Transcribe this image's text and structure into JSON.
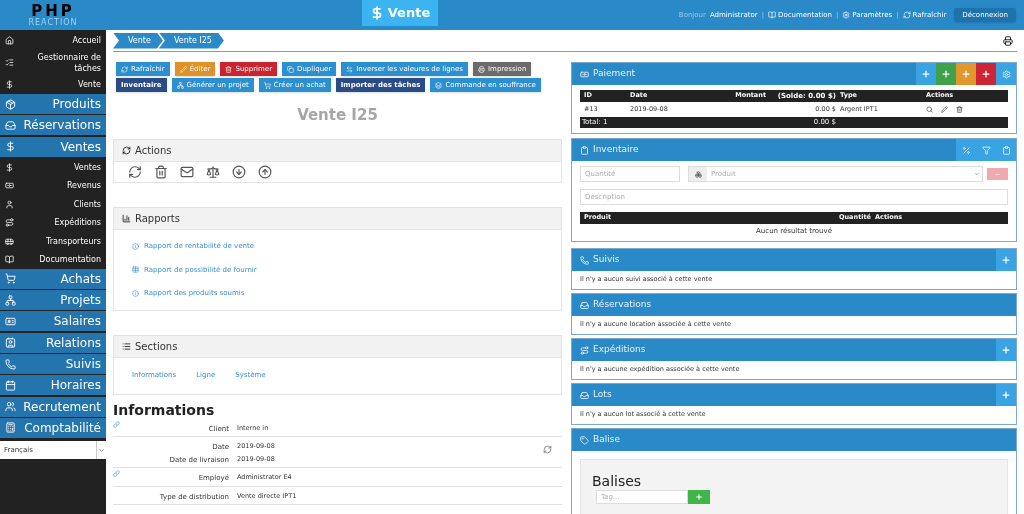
{
  "topbar": {
    "logo": "PHP",
    "logo_sub": "REACTION",
    "page_title": "Vente",
    "greeting": "Bonjour",
    "user": "Administrator",
    "separator": "|",
    "links": [
      "Documentation",
      "Paramètres",
      "Rafraîchir"
    ],
    "logout": "Déconnexion"
  },
  "sidebar": {
    "items": [
      {
        "kind": "link",
        "label": "Accueil"
      },
      {
        "kind": "link",
        "label": "Gestionnaire de tâches"
      },
      {
        "kind": "link",
        "label": "Vente"
      },
      {
        "kind": "section",
        "label": "Produits"
      },
      {
        "kind": "section",
        "label": "Réservations"
      },
      {
        "kind": "section",
        "label": "Ventes"
      },
      {
        "kind": "link",
        "label": "Ventes"
      },
      {
        "kind": "link",
        "label": "Revenus"
      },
      {
        "kind": "link",
        "label": "Clients"
      },
      {
        "kind": "link",
        "label": "Expéditions"
      },
      {
        "kind": "link",
        "label": "Transporteurs"
      },
      {
        "kind": "link",
        "label": "Documentation"
      },
      {
        "kind": "section",
        "label": "Achats"
      },
      {
        "kind": "section",
        "label": "Projets"
      },
      {
        "kind": "section",
        "label": "Salaires"
      },
      {
        "kind": "section",
        "label": "Relations"
      },
      {
        "kind": "section",
        "label": "Suivis"
      },
      {
        "kind": "section",
        "label": "Horaires"
      },
      {
        "kind": "section",
        "label": "Recrutement"
      },
      {
        "kind": "section",
        "label": "Comptabilité"
      }
    ],
    "language": "Français"
  },
  "breadcrumb": [
    "Vente",
    "Vente I25"
  ],
  "toolbar": [
    {
      "label": "Rafraîchir",
      "kind": "info"
    },
    {
      "label": "Éditer",
      "kind": "warning"
    },
    {
      "label": "Supprimer",
      "kind": "danger"
    },
    {
      "label": "Dupliquer",
      "kind": "info"
    },
    {
      "label": "Inverser les valeures de lignes",
      "kind": "info"
    },
    {
      "label": "Impression",
      "kind": "muted"
    },
    {
      "label": "Inventaire",
      "kind": "dark"
    },
    {
      "label": "Générer un projet",
      "kind": "info"
    },
    {
      "label": "Créer un achat",
      "kind": "info"
    },
    {
      "label": "Importer des tâches",
      "kind": "dark"
    },
    {
      "label": "Commande en souffrance",
      "kind": "info"
    }
  ],
  "title": "Vente I25",
  "actions_panel": {
    "title": "Actions"
  },
  "reports_panel": {
    "title": "Rapports",
    "links": [
      "Rapport de rentabilité de vente",
      "Rapport de possibilité de fournir",
      "Rapport des produits soumis"
    ]
  },
  "sections_panel": {
    "title": "Sections",
    "links": [
      "Informations",
      "Ligne",
      "Système"
    ]
  },
  "informations": {
    "title": "Informations",
    "rows": [
      {
        "linked": true,
        "refresh": false,
        "fields": [
          {
            "label": "Client",
            "value": "Interne in"
          }
        ]
      },
      {
        "linked": false,
        "refresh": true,
        "fields": [
          {
            "label": "Date",
            "value": "2019-09-08"
          },
          {
            "label": "Date de livraison",
            "value": "2019-09-08"
          }
        ]
      },
      {
        "linked": true,
        "refresh": false,
        "fields": [
          {
            "label": "Employé",
            "value": "Administrator E4"
          }
        ]
      },
      {
        "linked": false,
        "refresh": false,
        "fields": [
          {
            "label": "Type de distribution",
            "value": "Vente directe IPT1"
          }
        ]
      }
    ]
  },
  "payment": {
    "title": "Paiement",
    "header_buttons": [
      {
        "kind": "add",
        "color": "#3aa3e3"
      },
      {
        "kind": "add",
        "color": "#3fa14a"
      },
      {
        "kind": "add",
        "color": "#e0982e"
      },
      {
        "kind": "add",
        "color": "#cc2535"
      },
      {
        "kind": "settings",
        "color": "#3aa3e3"
      }
    ],
    "columns": [
      "ID",
      "Date",
      "Montant",
      "(Solde: 0.00 $)",
      "Type",
      "Actions"
    ],
    "rows": [
      {
        "id": "#13",
        "date": "2019-09-08",
        "amount": "0.00 $",
        "type": "Argent IPT1"
      }
    ],
    "footer": {
      "total": "Total: 1",
      "amount": "0.00 $"
    }
  },
  "inventory": {
    "title": "Inventaire",
    "quantity_placeholder": "Quantité",
    "product_placeholder": "Produit",
    "description_placeholder": "Description",
    "columns": [
      "Produit",
      "Quantité",
      "Actions"
    ],
    "empty": "Aucun résultat trouvé"
  },
  "panels": [
    {
      "title": "Suivis",
      "message": "Il n'y a aucun suivi associé à cette vente",
      "can_add": true
    },
    {
      "title": "Réservations",
      "message": "Il n'y a aucune location associée à cette vente",
      "can_add": false
    },
    {
      "title": "Expéditions",
      "message": "Il n'y a aucune expédition associée à cette vente",
      "can_add": true
    },
    {
      "title": "Lots",
      "message": "Il n'y a aucun lot associé à cette vente",
      "can_add": true
    }
  ],
  "tags": {
    "title": "Balise",
    "heading": "Balises",
    "placeholder": "Tag..."
  }
}
